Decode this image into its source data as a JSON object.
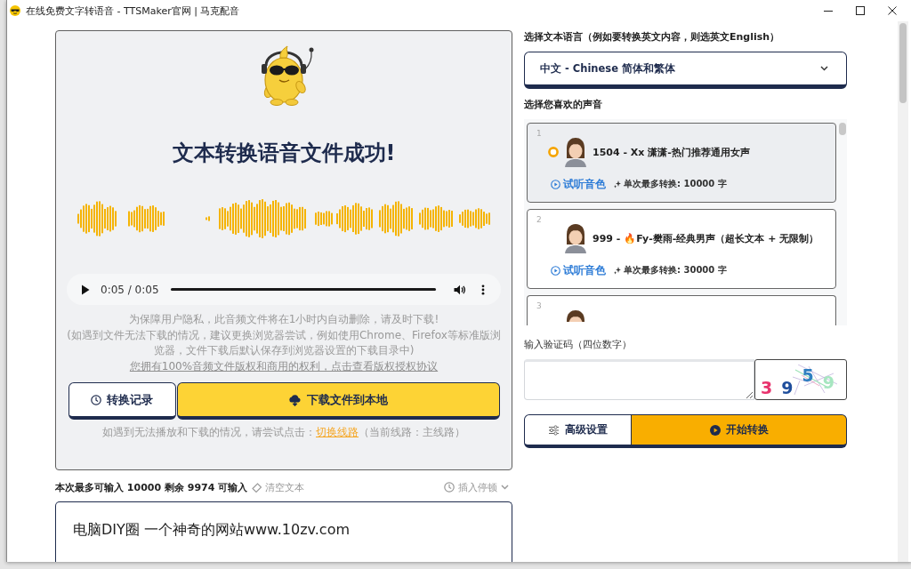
{
  "window": {
    "title": "在线免费文字转语音 - TTSMaker官网 | 马克配音"
  },
  "result_panel": {
    "title": "文本转换语音文件成功!",
    "player": {
      "time": "0:05 / 0:05",
      "level": 1
    },
    "notices": [
      "为保障用户隐私，此音频文件将在1小时内自动删除，请及时下载!",
      "(如遇到文件无法下载的情况，建议更换浏览器尝试，例如使用Chrome、Firefox等标准版浏览器，文件下载后默认保存到浏览器设置的下载目录中)"
    ],
    "license_link": "您拥有100%音频文件版权和商用的权利，点击查看版权授权协议",
    "buttons": [
      {
        "kind": "history",
        "label": "转换记录"
      },
      {
        "kind": "download",
        "label": "下载文件到本地"
      }
    ],
    "route_hint": {
      "text": "如遇到无法播放和下载的情况，请尝试点击：",
      "link": "切换线路",
      "suffix": "（当前线路：主线路）"
    }
  },
  "text_input": {
    "limit_note": "本次最多可输入 10000 剩余 9974 可输入",
    "clear": "清空文本",
    "pause": "插入停顿",
    "value": "电脑DIY圈 一个神奇的网站www.10zv.com"
  },
  "language": {
    "label": "选择文本语言（例如要转换英文内容，则选英文English）",
    "value": "中文 - Chinese 简体和繁体"
  },
  "voices": {
    "label": "选择您喜欢的声音",
    "items": [
      {
        "index": "1",
        "name": "1504 - Xx 潇潇-热门推荐通用女声",
        "preview": "试听音色",
        "limit": "单次最多转换: 10000 字",
        "selected": true
      },
      {
        "index": "2",
        "name": "999 - 🔥Fy-樊雨-经典男声（超长文本 + 无限制）",
        "preview": "试听音色",
        "limit": "单次最多转换: 30000 字",
        "selected": false
      },
      {
        "index": "3",
        "selected": false
      }
    ]
  },
  "captcha": {
    "label": "输入验证码（四位数字）",
    "chars": [
      {
        "char": "3",
        "color": "#e8336d"
      },
      {
        "char": "9",
        "color": "#1f4e9c"
      },
      {
        "char": "5",
        "color": "#2f7fc1"
      },
      {
        "char": "9",
        "color": "#a6e6c0"
      }
    ]
  },
  "actions": [
    {
      "kind": "settings",
      "label": "高级设置"
    },
    {
      "kind": "convert",
      "label": "开始转换"
    }
  ]
}
